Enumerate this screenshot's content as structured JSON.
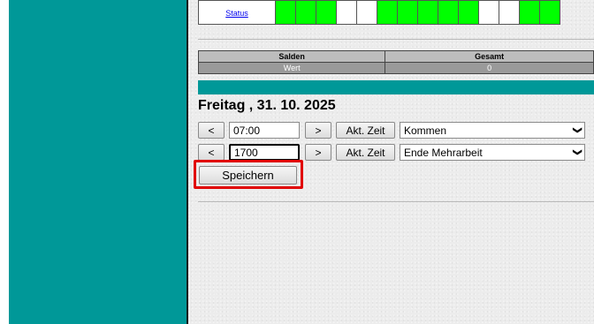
{
  "status": {
    "link_label": "Status",
    "tiles": [
      "#00ff00",
      "#00ff00",
      "#00ff00",
      "#ffffff",
      "#ffffff",
      "#00ff00",
      "#00ff00",
      "#00ff00",
      "#00ff00",
      "#00ff00",
      "#ffffff",
      "#ffffff",
      "#00ff00",
      "#00ff00"
    ]
  },
  "salden": {
    "headers": [
      "Salden",
      "Gesamt"
    ],
    "row": [
      "Wert",
      "0"
    ]
  },
  "day": {
    "title": "Freitag , 31. 10. 2025"
  },
  "entries": [
    {
      "prev_label": "<",
      "time": "07:00",
      "next_label": ">",
      "now_label": "Akt. Zeit",
      "type": "Kommen"
    },
    {
      "prev_label": "<",
      "time": "1700",
      "next_label": ">",
      "now_label": "Akt. Zeit",
      "type": "Ende Mehrarbeit"
    }
  ],
  "save_label": "Speichern",
  "colors": {
    "sidebar": "#009898",
    "highlight": "#e10000",
    "green_tile": "#00ff00"
  }
}
